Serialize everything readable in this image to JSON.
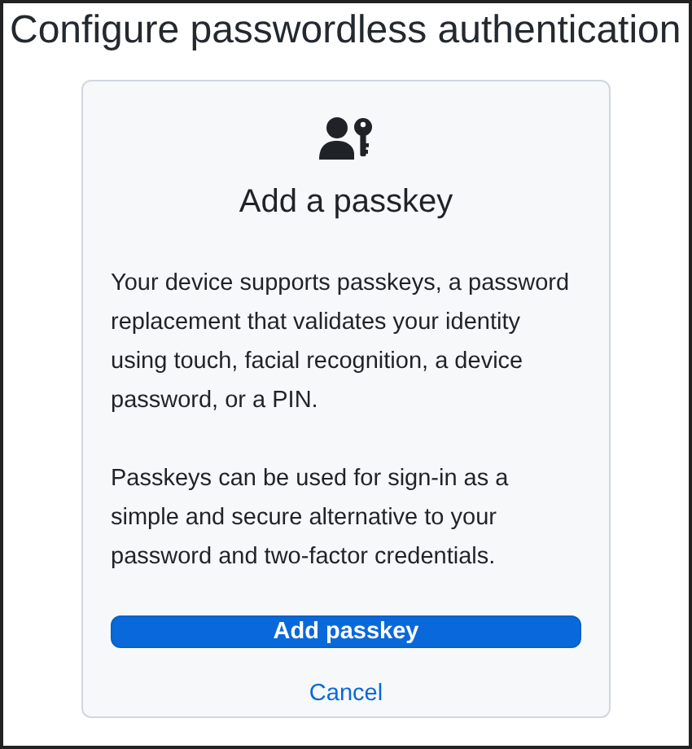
{
  "title": "Configure passwordless authentication",
  "card": {
    "heading": "Add a passkey",
    "paragraphs": [
      "Your device supports passkeys, a password replacement that validates your identity using touch, facial recognition, a device password, or a PIN.",
      "Passkeys can be used for sign-in as a simple and secure alternative to your password and two-factor credentials."
    ],
    "primary_button": "Add passkey",
    "cancel_link": "Cancel"
  }
}
